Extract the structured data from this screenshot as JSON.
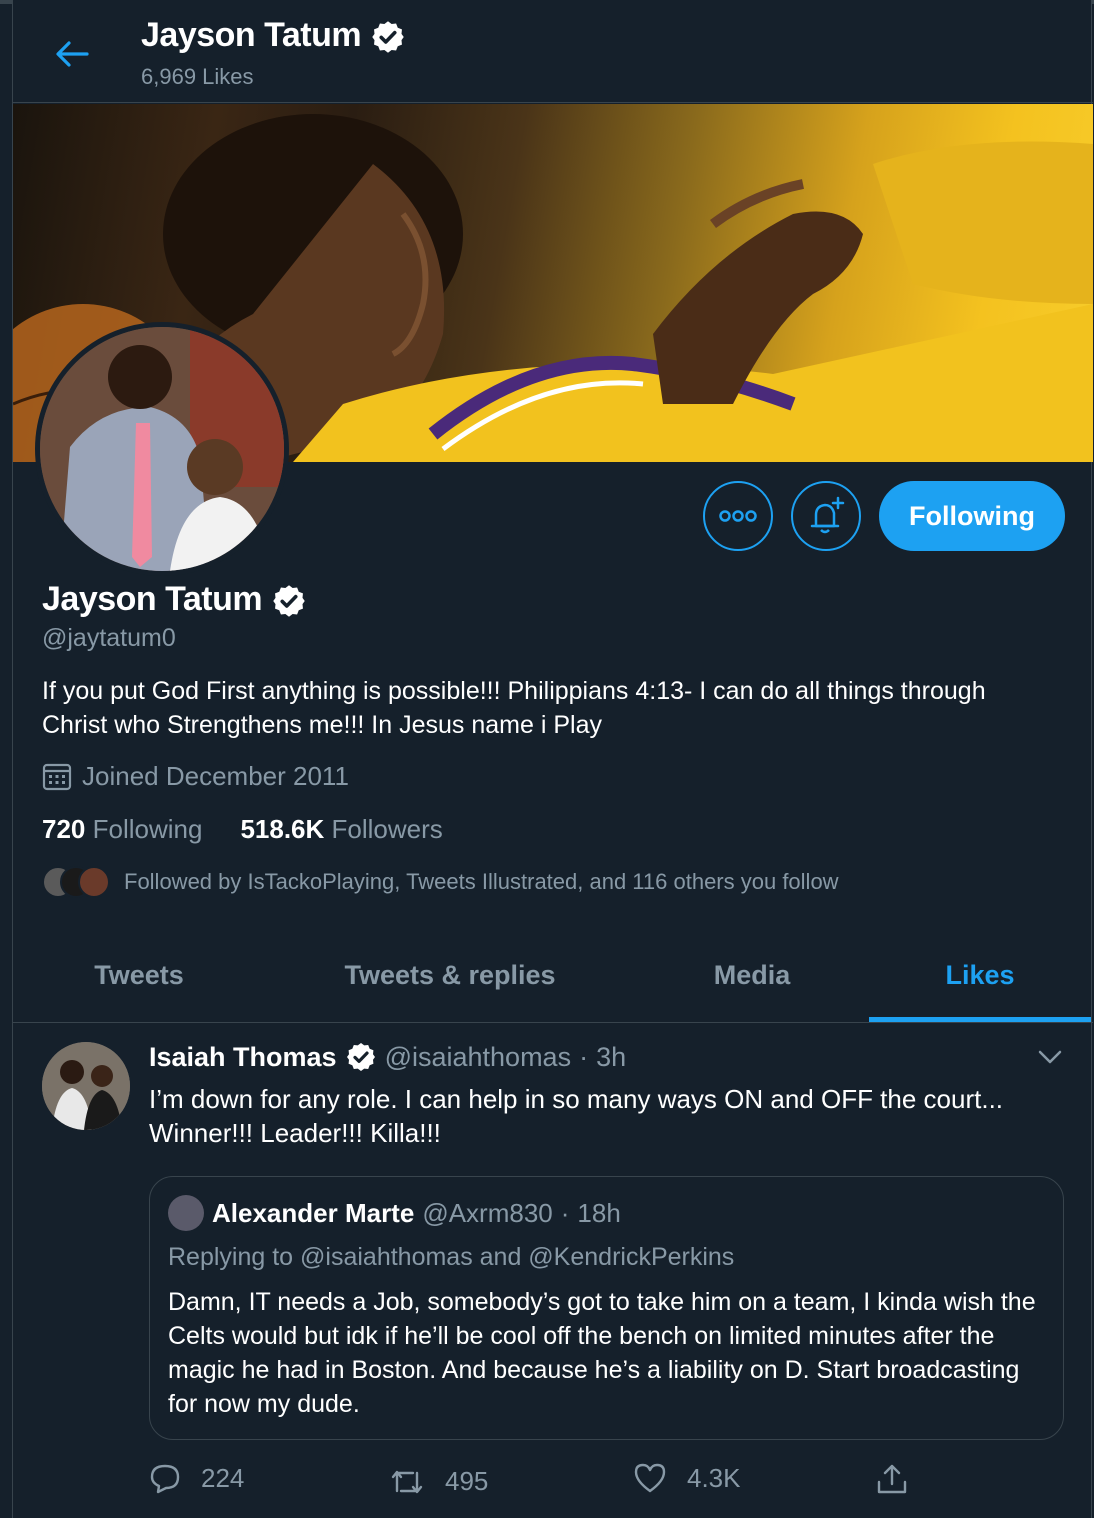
{
  "colors": {
    "background": "#15202b",
    "accent": "#1da1f2",
    "muted": "#8899a6",
    "border": "#38444d"
  },
  "header": {
    "back_icon": "arrow-left-icon",
    "name": "Jayson Tatum",
    "likes_count": "6,969 Likes"
  },
  "profile": {
    "name": "Jayson Tatum",
    "handle": "@jaytatum0",
    "bio": "If you put God First anything is possible!!! Philippians 4:13- I can do all things through Christ who Strengthens me!!! In Jesus name i Play",
    "joined": "Joined December 2011",
    "following_count": "720",
    "following_label": "Following",
    "followers_count": "518.6K",
    "followers_label": "Followers",
    "followed_by": "Followed by IsTackoPlaying, Tweets Illustrated, and 116 others you follow"
  },
  "actions": {
    "more_icon": "more-icon",
    "notify_icon": "bell-plus-icon",
    "follow_label": "Following"
  },
  "tabs": [
    {
      "label": "Tweets"
    },
    {
      "label": "Tweets & replies"
    },
    {
      "label": "Media"
    },
    {
      "label": "Likes"
    }
  ],
  "tweet": {
    "author_name": "Isaiah Thomas",
    "author_handle": "@isaiahthomas",
    "separator": "·",
    "time": "3h",
    "text": "I’m down for any role. I can help in so many ways ON and OFF the court... Winner!!! Leader!!! Killa!!!",
    "quote": {
      "author_name": "Alexander Marte",
      "author_handle": "@Axrm830",
      "separator": "·",
      "time": "18h",
      "replying_to": "Replying to @isaiahthomas and @KendrickPerkins",
      "text": "Damn, IT needs a Job, somebody’s got to take him on a team, I kinda wish the Celts would but idk if he’ll be cool off the bench on limited minutes after the magic he had in Boston. And because he’s a liability on D. Start broadcasting for now my dude."
    },
    "replies": "224",
    "retweets": "495",
    "likes": "4.3K"
  }
}
